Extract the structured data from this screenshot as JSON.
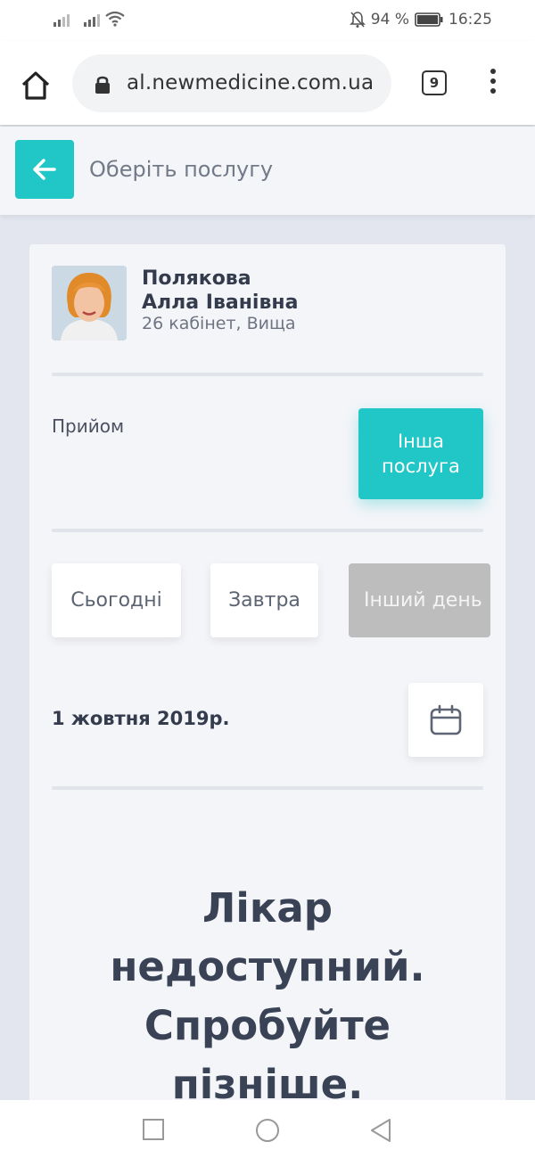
{
  "status_bar": {
    "battery": "94 %",
    "time": "16:25"
  },
  "browser": {
    "url": "al.newmedicine.com.ua",
    "tab_count": "9"
  },
  "header": {
    "title": "Оберіть послугу"
  },
  "doctor": {
    "surname": "Полякова",
    "given_names": "Алла Іванівна",
    "info": "26 кабінет, Вища"
  },
  "service": {
    "label": "Прийом",
    "other_button": "Інша послуга"
  },
  "days": {
    "today": "Сьогодні",
    "tomorrow": "Завтра",
    "other": "Інший день"
  },
  "date": {
    "selected": "1 жовтня 2019р."
  },
  "message": {
    "lines": [
      "Лікар",
      "недоступний.",
      "Спробуйте",
      "пізніше."
    ]
  },
  "colors": {
    "accent": "#21c6c6",
    "disabled": "#bdbdbd",
    "text_dark": "#333b4d"
  }
}
